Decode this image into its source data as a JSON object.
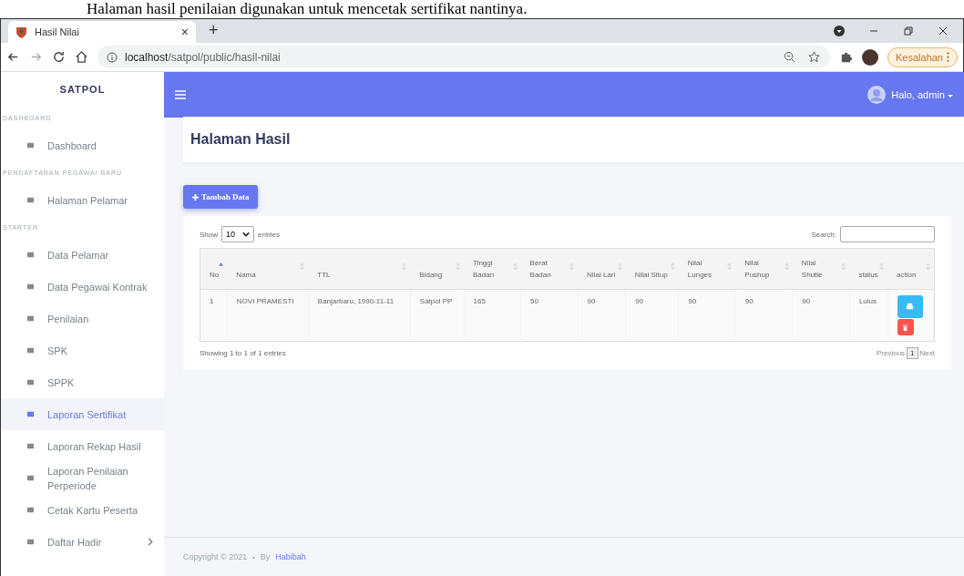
{
  "caption": "Halaman hasil penilaian digunakan untuk mencetak sertifikat nantinya.",
  "browser": {
    "tab": {
      "title": "Hasil Nilai",
      "close": "×"
    },
    "new_tab": "+",
    "url_host": "localhost",
    "url_path": "/satpol/public/hasil-nilai",
    "profile_button": "Kesalahan"
  },
  "sidebar": {
    "brand": "SATPOL",
    "items": [
      {
        "kind": "header",
        "label": "DASHBOARD"
      },
      {
        "kind": "item",
        "label": "Dashboard",
        "selected": false
      },
      {
        "kind": "header",
        "label": "PENDAFTARAN PEGAWAI BARU"
      },
      {
        "kind": "item",
        "label": "Halaman Pelamar",
        "selected": false
      },
      {
        "kind": "header",
        "label": "STARTER"
      },
      {
        "kind": "item",
        "label": "Data Pelamar",
        "selected": false
      },
      {
        "kind": "item",
        "label": "Data Pegawai Kontrak",
        "selected": false
      },
      {
        "kind": "item",
        "label": "Penilaian",
        "selected": false
      },
      {
        "kind": "item",
        "label": "SPK",
        "selected": false
      },
      {
        "kind": "item",
        "label": "SPPK",
        "selected": false
      },
      {
        "kind": "item",
        "label": "Laporan Sertifikat",
        "selected": true
      },
      {
        "kind": "item",
        "label": "Laporan Rekap Hasil",
        "selected": false
      },
      {
        "kind": "item",
        "label": "Laporan Penilaian Perperiode",
        "selected": false
      },
      {
        "kind": "item",
        "label": "Cetak Kartu Peserta",
        "selected": false
      },
      {
        "kind": "submenu",
        "label": "Daftar Hadir",
        "selected": false
      }
    ]
  },
  "navbar": {
    "user": "Halo, admin"
  },
  "page_title": "Halaman Hasil",
  "add_button": "Tambah Data",
  "table": {
    "show_label": "Show",
    "page_size": "10",
    "entries_label": "entries",
    "search_label": "Search:",
    "columns": [
      {
        "label": "No",
        "sorted": true
      },
      {
        "label": "Nama",
        "sorted": false
      },
      {
        "label": "TTL",
        "sorted": false
      },
      {
        "label": "Bidang",
        "sorted": false
      },
      {
        "label": "Tinggi Badan",
        "sorted": false
      },
      {
        "label": "Berat Badan",
        "sorted": false
      },
      {
        "label": "Nilai Lari",
        "sorted": false
      },
      {
        "label": "Nilai Situp",
        "sorted": false
      },
      {
        "label": "Nilai Lunges",
        "sorted": false
      },
      {
        "label": "Nilai Pushup",
        "sorted": false
      },
      {
        "label": "Nilai Shutle",
        "sorted": false
      },
      {
        "label": "status",
        "sorted": false
      },
      {
        "label": "action",
        "sorted": false
      }
    ],
    "rows": [
      {
        "cells": [
          "1",
          "NOVI PRAMESTI",
          "Banjarbaru, 1990-11-11",
          "Satpol PP",
          "165",
          "50",
          "90",
          "90",
          "90",
          "90",
          "90",
          "Lulus"
        ]
      }
    ],
    "info": "Showing 1 to 1 of 1 entries",
    "prev": "Previous",
    "page": "1",
    "next": "Next"
  },
  "footer": {
    "copyright": "Copyright © 2021",
    "dot": "•",
    "by": "By",
    "author": "Habibah"
  }
}
